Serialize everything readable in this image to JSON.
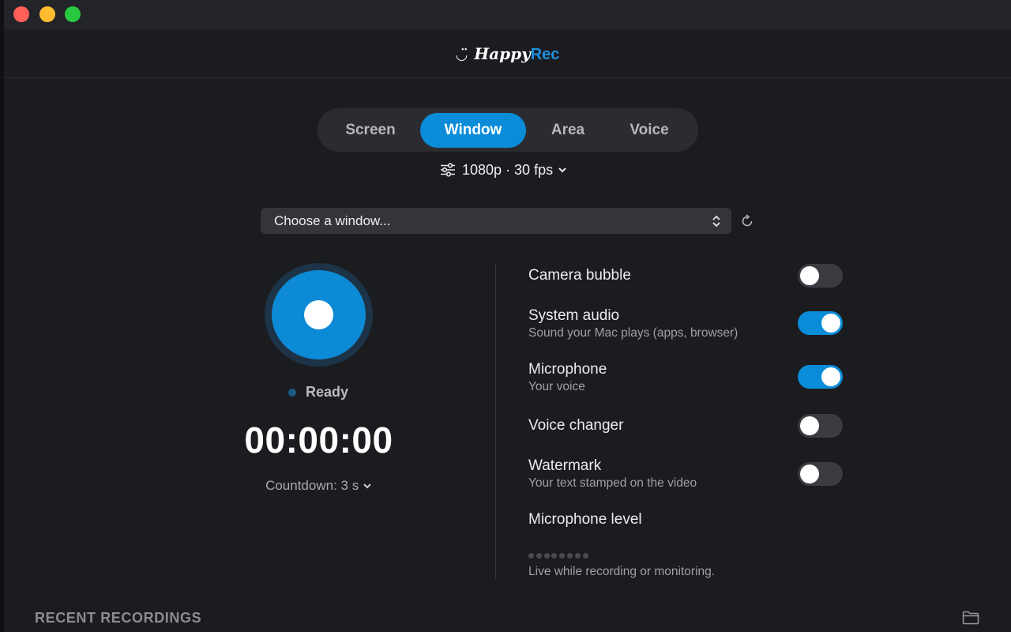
{
  "app": {
    "logo_happy": "Happy",
    "logo_rec": "Rec",
    "accent_color": "#0a8cd8"
  },
  "modes": {
    "tabs": [
      {
        "label": "Screen",
        "active": false
      },
      {
        "label": "Window",
        "active": true
      },
      {
        "label": "Area",
        "active": false
      },
      {
        "label": "Voice",
        "active": false
      }
    ]
  },
  "quality": {
    "label": "1080p · 30 fps",
    "icon": "sliders-icon"
  },
  "window_picker": {
    "value": "Choose a window...",
    "icon": "up-down-chevron-icon",
    "refresh_icon": "refresh-icon"
  },
  "recorder": {
    "status": "Ready",
    "timer": "00:00:00",
    "countdown": "Countdown: 3 s"
  },
  "options": [
    {
      "title": "Camera bubble",
      "subtitle": "",
      "on": false
    },
    {
      "title": "System audio",
      "subtitle": "Sound your Mac plays (apps, browser)",
      "on": true
    },
    {
      "title": "Microphone",
      "subtitle": "Your voice",
      "on": true
    },
    {
      "title": "Voice changer",
      "subtitle": "",
      "on": false
    },
    {
      "title": "Watermark",
      "subtitle": "Your text stamped on the video",
      "on": false
    }
  ],
  "mic_level": {
    "title": "Microphone level",
    "hint": "Live while recording or monitoring.",
    "level": 0
  },
  "recent": {
    "label": "RECENT RECORDINGS",
    "folder_icon": "folder-icon"
  }
}
